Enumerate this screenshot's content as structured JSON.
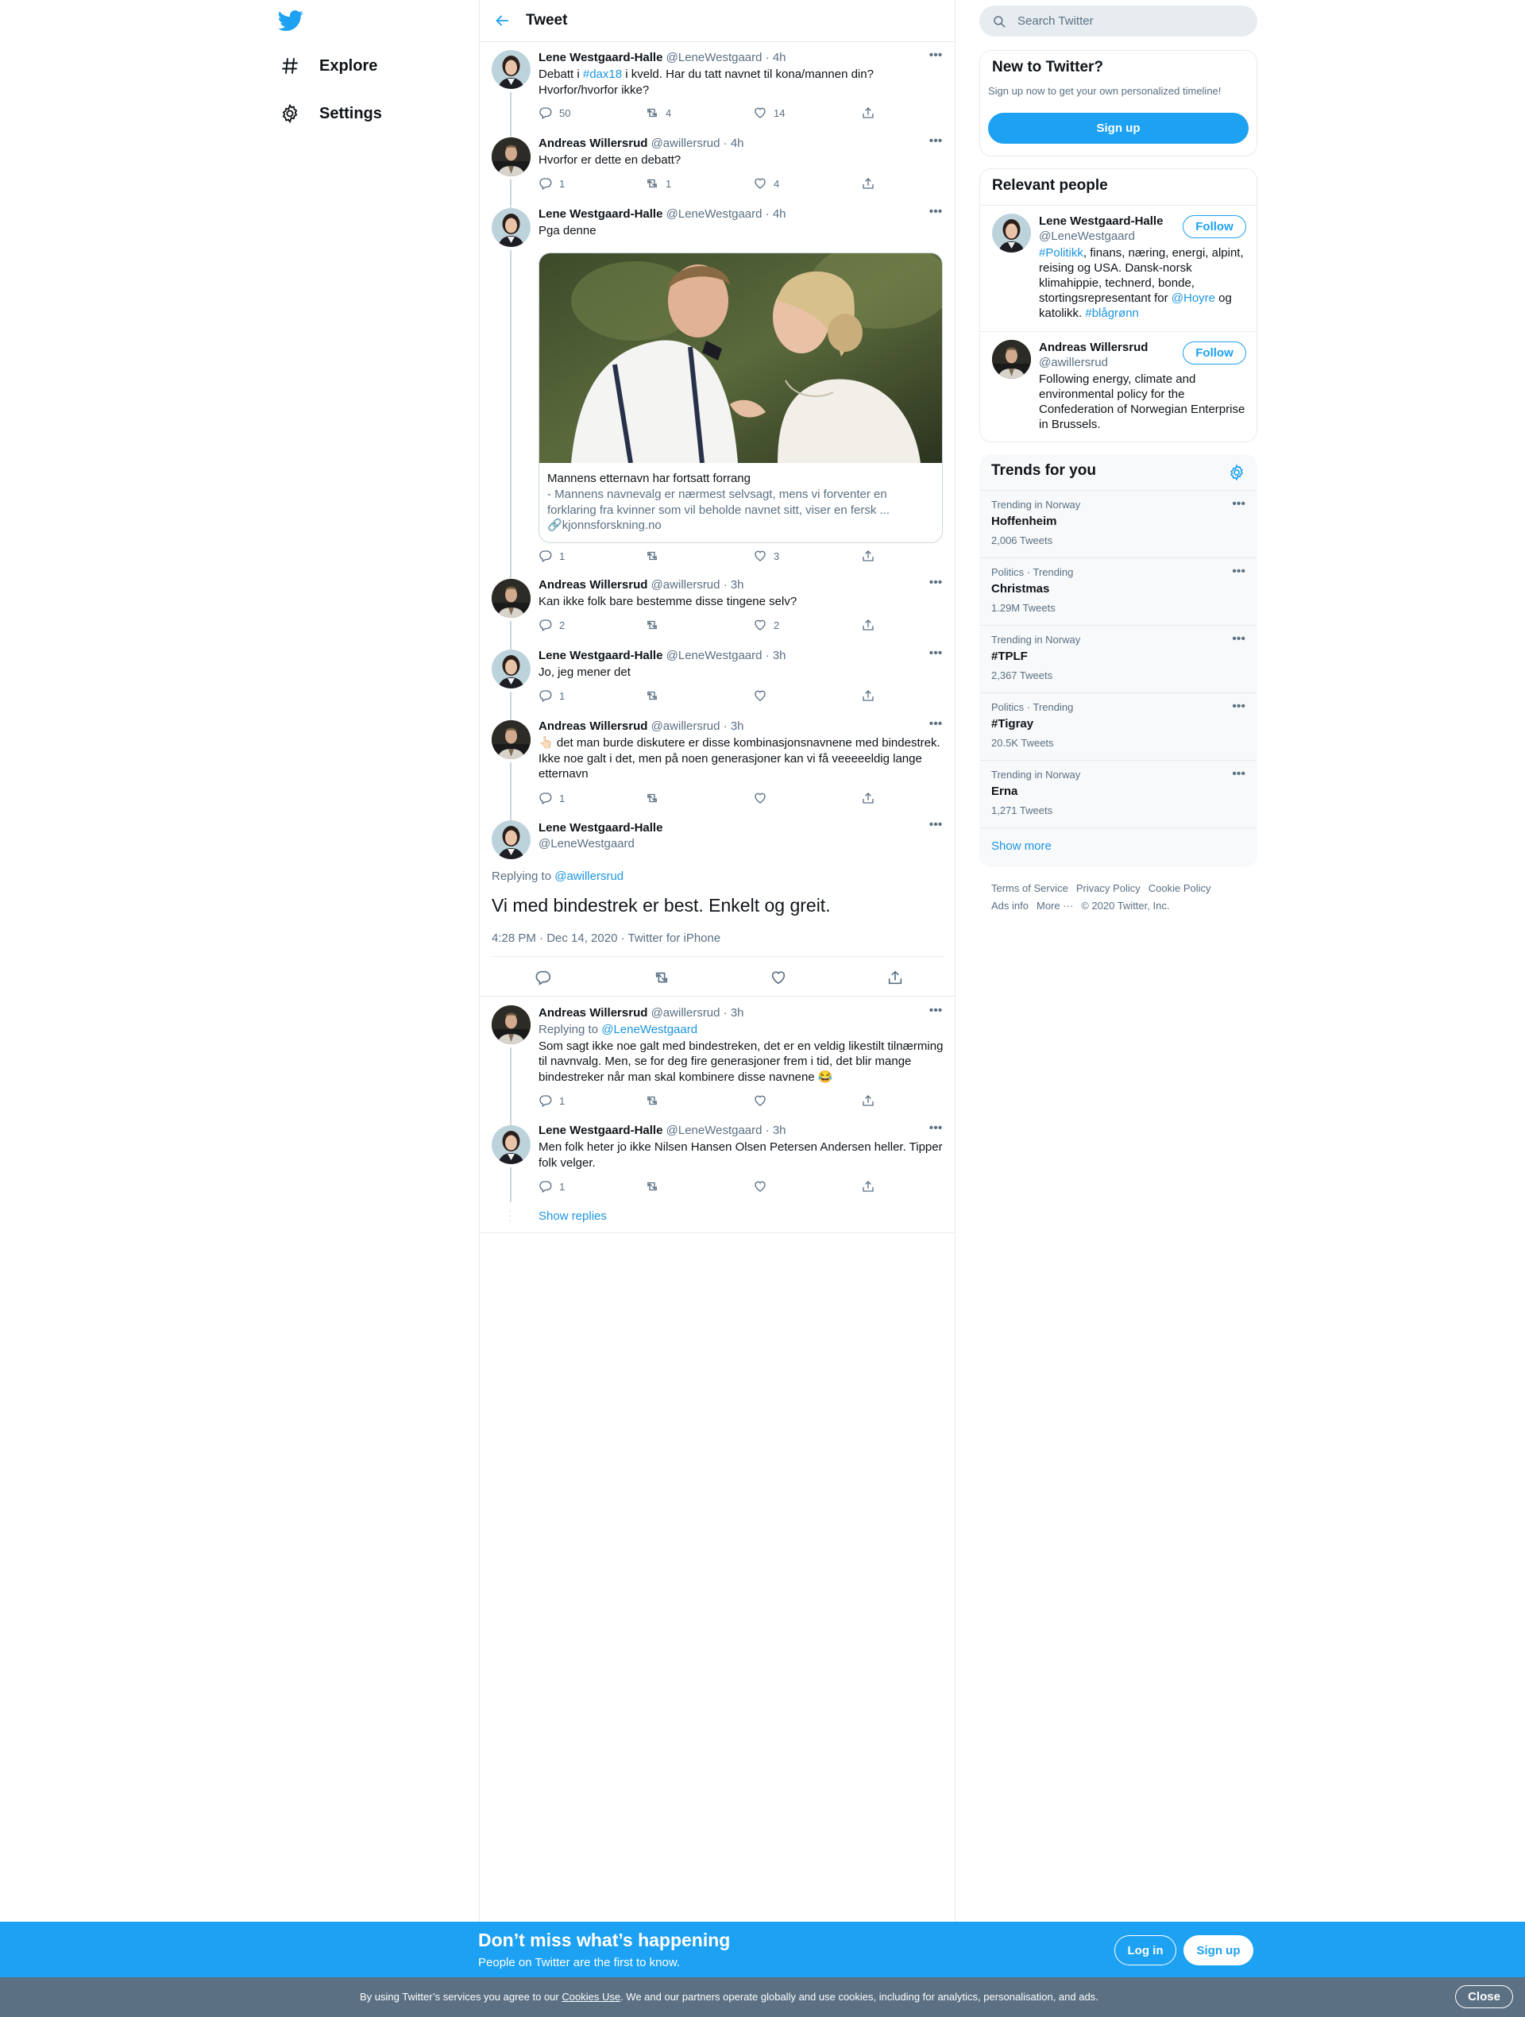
{
  "nav": {
    "explore": "Explore",
    "settings": "Settings"
  },
  "header": {
    "title": "Tweet"
  },
  "tweets": [
    {
      "name": "Lene Westgaard-Halle",
      "handle": "@LeneWestgaard",
      "time": "4h",
      "text_pre": "Debatt i ",
      "hashtag": "#dax18",
      "text_post": " i kveld. Har du tatt navnet til kona/mannen din? Hvorfor/hvorfor ikke?",
      "replies": "50",
      "retweets": "4",
      "likes": "14"
    },
    {
      "name": "Andreas Willersrud",
      "handle": "@awillersrud",
      "time": "4h",
      "text": "Hvorfor er dette en debatt?",
      "replies": "1",
      "retweets": "1",
      "likes": "4"
    },
    {
      "name": "Lene Westgaard-Halle",
      "handle": "@LeneWestgaard",
      "time": "4h",
      "text": "Pga denne",
      "card": {
        "title": "Mannens etternavn har fortsatt forrang",
        "desc": "- Mannens navnevalg er nærmest selvsagt, mens vi forventer en forklaring fra kvinner som vil beholde navnet sitt, viser en fersk ...",
        "domain": "kjonnsforskning.no"
      },
      "replies": "1",
      "retweets": "",
      "likes": "3"
    },
    {
      "name": "Andreas Willersrud",
      "handle": "@awillersrud",
      "time": "3h",
      "text": "Kan ikke folk bare bestemme disse tingene selv?",
      "replies": "2",
      "retweets": "",
      "likes": "2"
    },
    {
      "name": "Lene Westgaard-Halle",
      "handle": "@LeneWestgaard",
      "time": "3h",
      "text": "Jo, jeg mener det",
      "replies": "1",
      "retweets": "",
      "likes": ""
    },
    {
      "name": "Andreas Willersrud",
      "handle": "@awillersrud",
      "time": "3h",
      "emoji": "👆🏻",
      "text": " det man burde diskutere er disse kombinasjonsnavnene med bindestrek. Ikke noe galt i det, men på noen generasjoner kan vi få veeeeeldig lange etternavn",
      "replies": "1",
      "retweets": "",
      "likes": ""
    }
  ],
  "focus": {
    "name": "Lene Westgaard-Halle",
    "handle": "@LeneWestgaard",
    "replying_label": "Replying to ",
    "replying_to": "@awillersrud",
    "text": "Vi med bindestrek er best. Enkelt og greit.",
    "meta": "4:28 PM · Dec 14, 2020 · Twitter for iPhone"
  },
  "replies": [
    {
      "name": "Andreas Willersrud",
      "handle": "@awillersrud",
      "time": "3h",
      "replying_label": "Replying to ",
      "replying_to": "@LeneWestgaard",
      "text": "Som sagt ikke noe galt med bindestreken, det er en veldig likestilt tilnærming til navnvalg. Men, se for deg fire generasjoner frem i tid, det blir mange bindestreker når man skal kombinere disse navnene 😂",
      "replies": "1",
      "retweets": "",
      "likes": ""
    },
    {
      "name": "Lene Westgaard-Halle",
      "handle": "@LeneWestgaard",
      "time": "3h",
      "text": "Men folk heter jo ikke Nilsen Hansen Olsen Petersen Andersen heller. Tipper folk velger.",
      "replies": "1",
      "retweets": "",
      "likes": ""
    }
  ],
  "show_replies": "Show replies",
  "search": {
    "placeholder": "Search Twitter"
  },
  "new_to_twitter": {
    "title": "New to Twitter?",
    "subtitle": "Sign up now to get your own personalized timeline!",
    "button": "Sign up"
  },
  "relevant_people": {
    "title": "Relevant people",
    "follow": "Follow",
    "people": [
      {
        "name": "Lene Westgaard-Halle",
        "handle": "@LeneWestgaard",
        "bio_tag1": "#Politikk",
        "bio_1": ", finans, næring, energi, alpint, reising og USA. Dansk-norsk klimahippie, technerd, bonde, stortingsrepresentant for ",
        "bio_mention": "@Hoyre",
        "bio_2": " og katolikk. ",
        "bio_tag2": "#blågrønn"
      },
      {
        "name": "Andreas Willersrud",
        "handle": "@awillersrud",
        "bio": "Following energy, climate and environmental policy for the Confederation of Norwegian Enterprise in Brussels."
      }
    ]
  },
  "trends": {
    "title": "Trends for you",
    "items": [
      {
        "context": "Trending in Norway",
        "name": "Hoffenheim",
        "count": "2,006 Tweets"
      },
      {
        "context": "Politics · Trending",
        "name": "Christmas",
        "count": "1.29M Tweets"
      },
      {
        "context": "Trending in Norway",
        "name": "#TPLF",
        "count": "2,367 Tweets"
      },
      {
        "context": "Politics · Trending",
        "name": "#Tigray",
        "count": "20.5K Tweets"
      },
      {
        "context": "Trending in Norway",
        "name": "Erna",
        "count": "1,271 Tweets"
      }
    ],
    "show_more": "Show more"
  },
  "footer": {
    "terms": "Terms of Service",
    "privacy": "Privacy Policy",
    "cookie": "Cookie Policy",
    "ads": "Ads info",
    "more": "More ···",
    "copyright": "© 2020 Twitter, Inc."
  },
  "banner": {
    "title": "Don’t miss what’s happening",
    "subtitle": "People on Twitter are the first to know.",
    "login": "Log in",
    "signup": "Sign up"
  },
  "cookie": {
    "text_pre": "By using Twitter’s services you agree to our ",
    "link": "Cookies Use",
    "text_post": ". We and our partners operate globally and use cookies, including for analytics, personalisation, and ads.",
    "close": "Close"
  },
  "colors": {
    "accent": "#1da1f2",
    "link": "#1b95e0",
    "secondary_text": "#5b7083",
    "border": "#e6ecf0",
    "cookie_bar": "#5b7083"
  }
}
